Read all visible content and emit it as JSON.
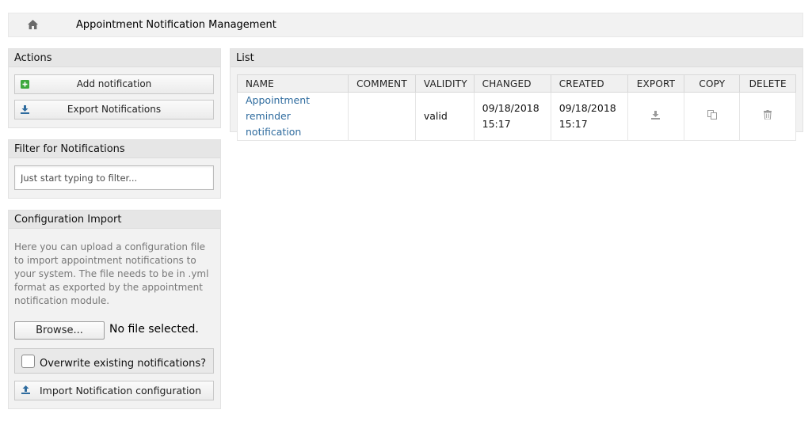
{
  "breadcrumb": {
    "home_icon": "home-icon",
    "title": "Appointment Notification Management"
  },
  "actions": {
    "header": "Actions",
    "add_label": "Add notification",
    "export_label": "Export Notifications"
  },
  "filter": {
    "header": "Filter for Notifications",
    "placeholder": "Just start typing to filter..."
  },
  "import": {
    "header": "Configuration Import",
    "description": "Here you can upload a configuration file to import appointment notifications to your system. The file needs to be in .yml format as exported by the appointment notification module.",
    "browse_label": "Browse...",
    "no_file_label": "No file selected.",
    "overwrite_label": "Overwrite existing notifications?",
    "overwrite_checked": false,
    "import_label": "Import Notification configuration"
  },
  "list": {
    "header": "List",
    "columns": [
      "NAME",
      "COMMENT",
      "VALIDITY",
      "CHANGED",
      "CREATED",
      "EXPORT",
      "COPY",
      "DELETE"
    ],
    "rows": [
      {
        "name": "Appointment reminder notification",
        "comment": "",
        "validity": "valid",
        "changed": "09/18/2018 15:17",
        "created": "09/18/2018 15:17",
        "export_icon": "download-icon",
        "copy_icon": "copy-icon",
        "delete_icon": "trash-icon"
      }
    ]
  },
  "colors": {
    "link": "#2e6b9e",
    "add_icon": "#3ea83e",
    "export_icon": "#2e6b9e",
    "panel_bg": "#f2f2f2",
    "panel_header_bg": "#e6e6e6"
  }
}
